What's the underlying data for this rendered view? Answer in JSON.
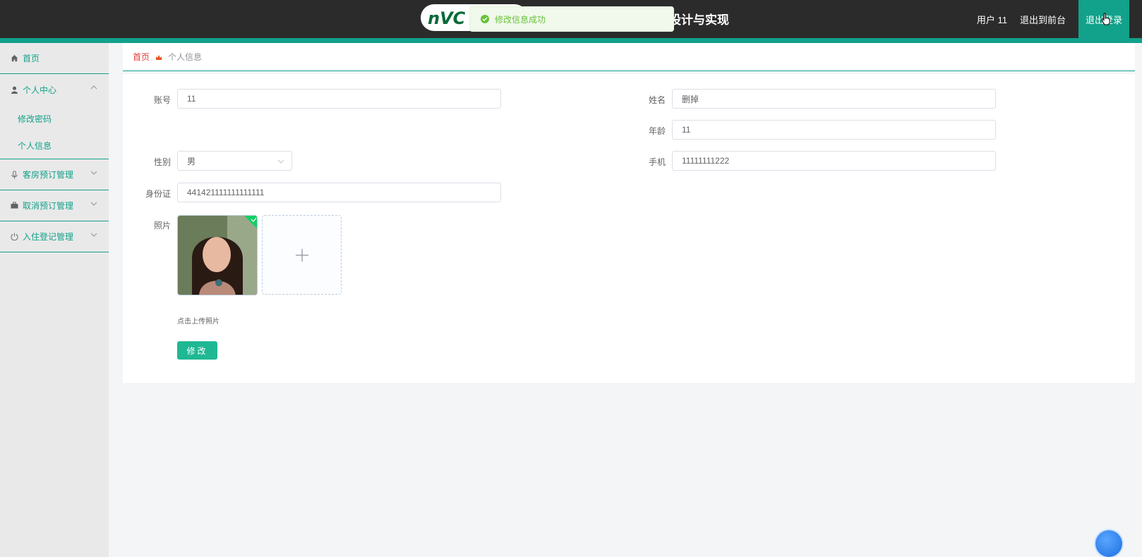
{
  "header": {
    "logo_text": "NVC",
    "title": "设计与实现",
    "user_label": "用户 11",
    "back_to_front": "退出到前台",
    "logout": "退出登录"
  },
  "toast": {
    "message": "修改信息成功",
    "type": "success"
  },
  "sidebar": {
    "items": [
      {
        "label": "首页",
        "icon": "home-icon"
      },
      {
        "label": "个人中心",
        "icon": "user-icon",
        "expanded": true,
        "children": [
          {
            "label": "修改密码"
          },
          {
            "label": "个人信息"
          }
        ]
      },
      {
        "label": "客房预订管理",
        "icon": "microphone-icon"
      },
      {
        "label": "取消预订管理",
        "icon": "briefcase-icon"
      },
      {
        "label": "入住登记管理",
        "icon": "power-icon"
      }
    ]
  },
  "breadcrumb": {
    "home": "首页",
    "current": "个人信息"
  },
  "form": {
    "account_label": "账号",
    "account_value": "11",
    "name_label": "姓名",
    "name_value": "删掉",
    "age_label": "年龄",
    "age_value": "11",
    "gender_label": "性别",
    "gender_value": "男",
    "phone_label": "手机",
    "phone_value": "11111111222",
    "id_label": "身份证",
    "id_value": "441421111111111111",
    "photo_label": "照片",
    "upload_tip": "点击上传照片",
    "submit_label": "修改"
  },
  "colors": {
    "accent": "#12a18a",
    "header_bg": "#2b2b2b",
    "button": "#1fb893",
    "breadcrumb_home": "#e13c3c",
    "toast_text": "#67c23a"
  }
}
